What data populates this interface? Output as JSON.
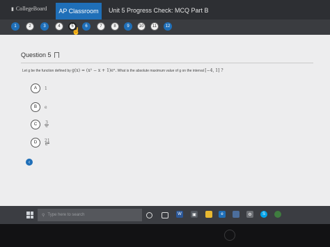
{
  "header": {
    "brand": "CollegeBoard",
    "active_tab": "AP Classroom",
    "exam_title": "Unit 5 Progress Check: MCQ Part B"
  },
  "question_nav": {
    "items": [
      "1",
      "2",
      "3",
      "4",
      "5",
      "6",
      "7",
      "8",
      "9",
      "10",
      "11",
      "12"
    ],
    "current": "5"
  },
  "question": {
    "heading": "Question 5",
    "stem_text": "Let g be the function defined by",
    "stem_formula": "g(x) = (x² − x + 1)eˣ.",
    "stem_text2": "What is the absolute maximum value of g on the interval",
    "stem_interval": "[−4, 1] ?"
  },
  "options": [
    {
      "letter": "A",
      "value": "1"
    },
    {
      "letter": "B",
      "value": "e"
    },
    {
      "letter": "C",
      "num": "3",
      "den": "e"
    },
    {
      "letter": "D",
      "num": "21",
      "den": "e⁴"
    }
  ],
  "taskbar": {
    "search_placeholder": "Type here to search",
    "apps": [
      "cortana-icon",
      "task-view-icon",
      "word-icon",
      "store-icon",
      "file-explorer-icon",
      "edge-icon",
      "photos-icon",
      "settings-icon",
      "skype-icon",
      "chrome-icon"
    ]
  },
  "hardware": {
    "logo": "hp"
  },
  "colors": {
    "accent": "#1f6fb8",
    "topbar": "#2d2f33",
    "content": "#ededee"
  }
}
